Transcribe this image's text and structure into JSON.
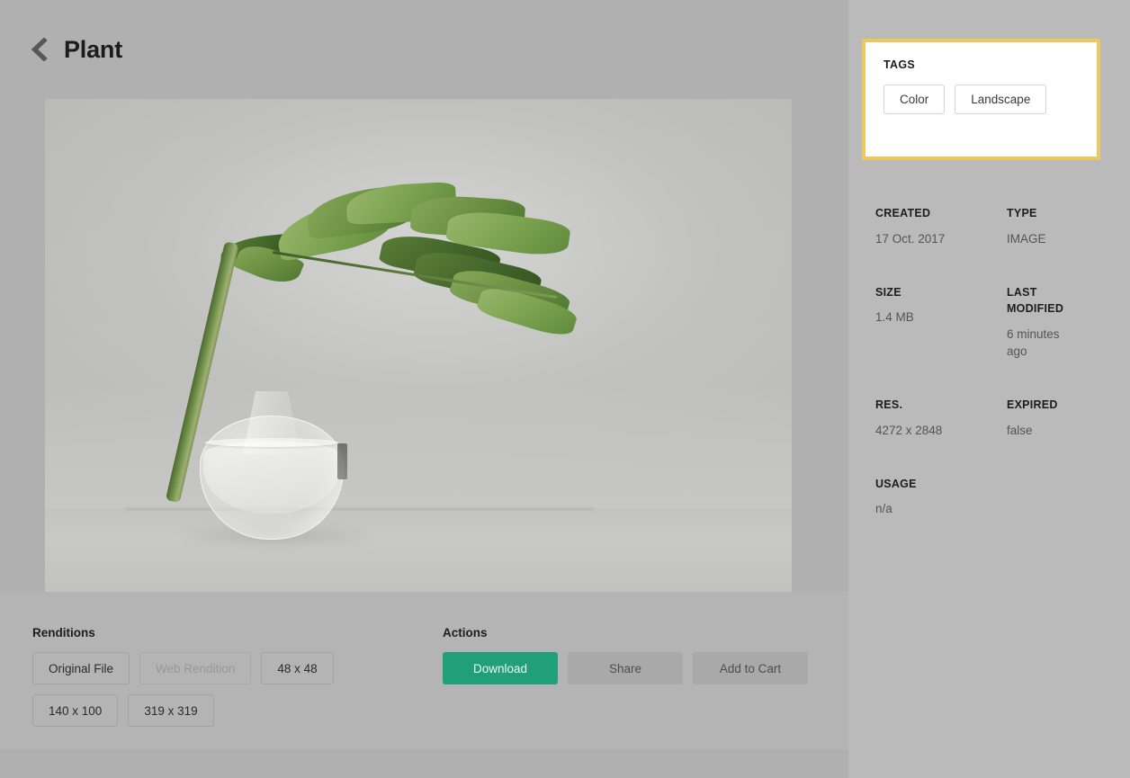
{
  "header": {
    "back_icon": "chevron-left-icon",
    "title": "Plant"
  },
  "image_viewer": {
    "alt": "Green monstera leaf in a clear glass vase on a white surface"
  },
  "renditions": {
    "title": "Renditions",
    "items": [
      {
        "label": "Original File",
        "disabled": false
      },
      {
        "label": "Web Rendition",
        "disabled": true
      },
      {
        "label": "48 x 48",
        "disabled": false
      },
      {
        "label": "140 x 100",
        "disabled": false
      },
      {
        "label": "319 x 319",
        "disabled": false
      }
    ]
  },
  "actions": {
    "title": "Actions",
    "items": [
      {
        "label": "Download",
        "style": "primary"
      },
      {
        "label": "Share",
        "style": "secondary"
      },
      {
        "label": "Add to Cart",
        "style": "secondary"
      }
    ]
  },
  "sidebar": {
    "tags_panel": {
      "label": "TAGS",
      "highlight_color": "#ecc95e",
      "tags": [
        {
          "label": "Color"
        },
        {
          "label": "Landscape"
        }
      ]
    },
    "metadata": [
      {
        "key": "CREATED",
        "value": "17 Oct. 2017"
      },
      {
        "key": "TYPE",
        "value": "IMAGE"
      },
      {
        "key": "SIZE",
        "value": "1.4 MB"
      },
      {
        "key": "LAST MODIFIED",
        "value": "6 minutes ago"
      },
      {
        "key": "RES.",
        "value": "4272 x 2848"
      },
      {
        "key": "EXPIRED",
        "value": "false"
      },
      {
        "key": "USAGE",
        "value": "n/a"
      }
    ]
  },
  "colors": {
    "page_background": "#b4b4b4",
    "sidebar_background": "#bababa",
    "panel_background": "#ffffff",
    "accent_green": "#21a077",
    "highlight_gold": "#ecc95e"
  }
}
